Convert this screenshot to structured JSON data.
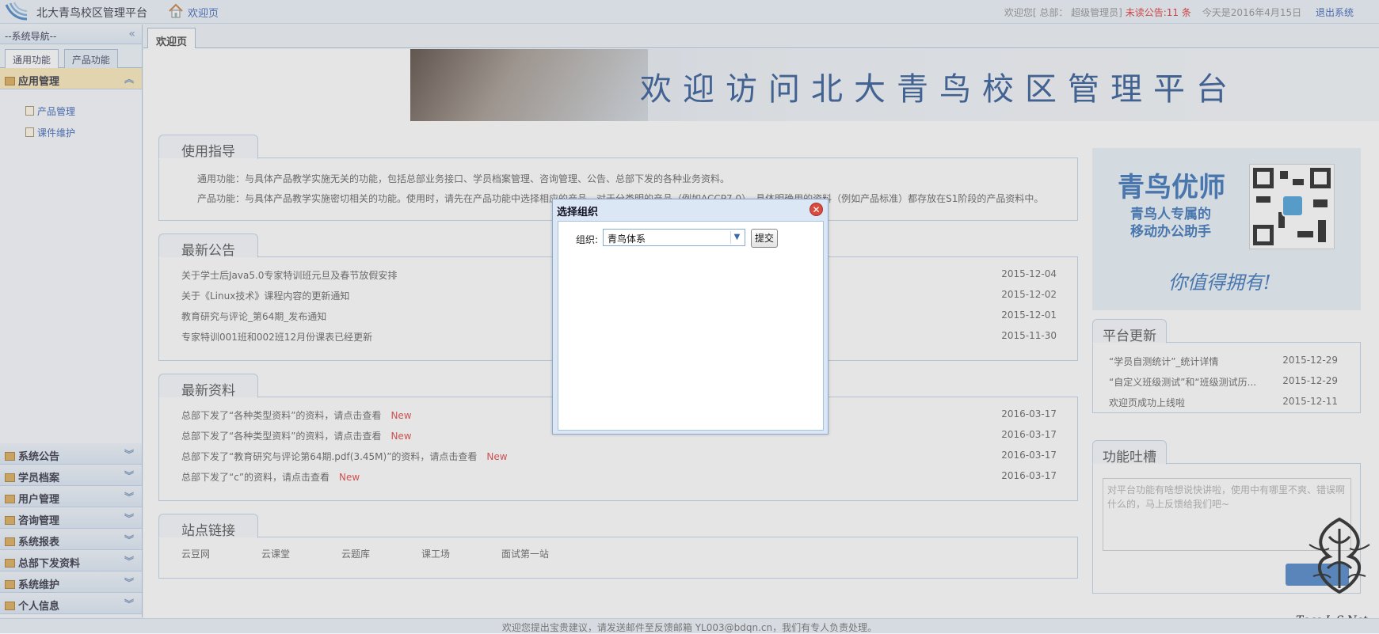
{
  "header": {
    "app_title": "北大青鸟校区管理平台",
    "home_link": "欢迎页",
    "welcome_prefix": "欢迎您[ 总部：  超级管理员]",
    "unread_prefix": "未读公告:",
    "unread_count": "11",
    "unread_unit": "条",
    "date_text": "今天是2016年4月15日",
    "logout": "退出系统"
  },
  "sidebar": {
    "title": "--系统导航--",
    "collapse_icon": "double-chevron-left-icon",
    "tabs": [
      "通用功能",
      "产品功能"
    ],
    "open_section": {
      "label": "应用管理",
      "items": [
        "产品管理",
        "课件维护"
      ]
    },
    "sections": [
      "系统公告",
      "学员档案",
      "用户管理",
      "咨询管理",
      "系统报表",
      "总部下发资料",
      "系统维护",
      "个人信息"
    ]
  },
  "main": {
    "tab": "欢迎页",
    "banner_text": "欢迎访问北大青鸟校区管理平台",
    "guide": {
      "title": "使用指导",
      "lines": [
        "通用功能：与具体产品教学实施无关的功能，包括总部业务接口、学员档案管理、咨询管理、公告、总部下发的各种业务资料。",
        "产品功能：与具体产品教学实施密切相关的功能。使用时，请先在产品功能中选择相应的产品，对于分类明的产品（例如ACCP7.0），具体明确用的资料（例如产品标准）都存放在S1阶段的产品资料中。"
      ]
    },
    "notices": {
      "title": "最新公告",
      "rows": [
        {
          "text": "关于学士后Java5.0专家特训班元旦及春节放假安排",
          "date": "2015-12-04"
        },
        {
          "text": "关于《Linux技术》课程内容的更新通知",
          "date": "2015-12-02"
        },
        {
          "text": "教育研究与评论_第64期_发布通知",
          "date": "2015-12-01"
        },
        {
          "text": "专家特训001班和002班12月份课表已经更新",
          "date": "2015-11-30"
        }
      ]
    },
    "materials": {
      "title": "最新资料",
      "new_label": "New",
      "rows": [
        {
          "text": "总部下发了“各种类型资料”的资料，请点击查看",
          "date": "2016-03-17"
        },
        {
          "text": "总部下发了“各种类型资料”的资料，请点击查看",
          "date": "2016-03-17"
        },
        {
          "text": "总部下发了“教育研究与评论第64期.pdf(3.45M)”的资料，请点击查看",
          "date": "2016-03-17"
        },
        {
          "text": "总部下发了“c”的资料，请点击查看",
          "date": "2016-03-17"
        }
      ]
    },
    "links": {
      "title": "站点链接",
      "items": [
        "云豆网",
        "云课堂",
        "云题库",
        "课工场",
        "面试第一站"
      ]
    }
  },
  "right": {
    "ad": {
      "title": "青鸟优师",
      "line1": "青鸟人专属的",
      "line2": "移动办公助手",
      "slogan": "你值得拥有!"
    },
    "updates": {
      "title": "平台更新",
      "rows": [
        {
          "text": "“学员自测统计”_统计详情",
          "date": "2015-12-29"
        },
        {
          "text": "“自定义班级测试”和“班级测试历...",
          "date": "2015-12-29"
        },
        {
          "text": "欢迎页成功上线啦",
          "date": "2015-12-11"
        }
      ]
    },
    "feedback": {
      "title": "功能吐槽",
      "placeholder": "对平台功能有啥想说快讲啦，使用中有哪里不爽、错误啊什么的，马上反馈给我们吧~"
    }
  },
  "watermark": "Tags L S.Net",
  "footer": {
    "text": "欢迎您提出宝贵建议，请发送邮件至反馈邮箱 YL003@bdqn.cn，我们有专人负责处理。"
  },
  "dialog": {
    "title": "选择组织",
    "close_icon": "close-icon",
    "org_label": "组织:",
    "org_value": "青鸟体系",
    "submit": "提交"
  }
}
